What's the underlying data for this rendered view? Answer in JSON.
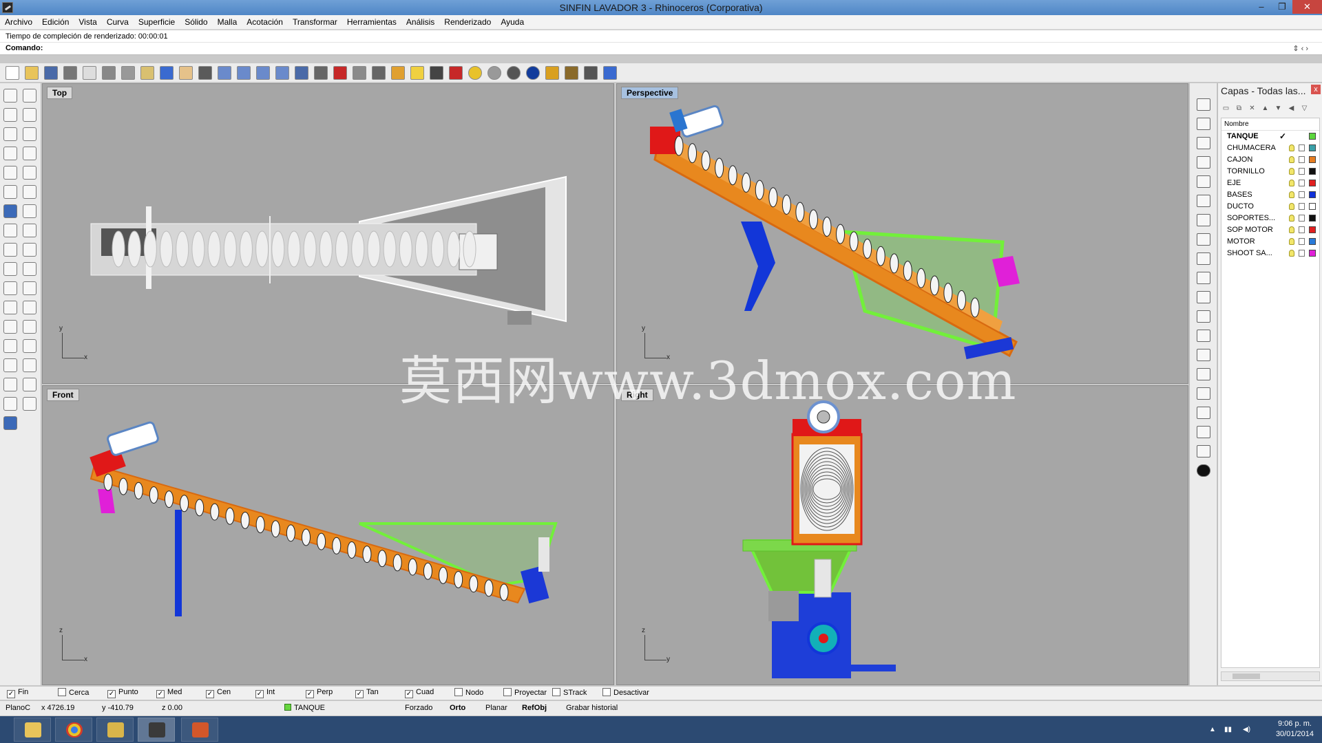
{
  "window": {
    "title": "SINFIN LAVADOR 3 - Rhinoceros (Corporativa)",
    "minimize": "–",
    "maximize": "❐",
    "close": "✕"
  },
  "menu": [
    "Archivo",
    "Edición",
    "Vista",
    "Curva",
    "Superficie",
    "Sólido",
    "Malla",
    "Acotación",
    "Transformar",
    "Herramientas",
    "Análisis",
    "Renderizado",
    "Ayuda"
  ],
  "command": {
    "history": "Tiempo de compleción de renderizado: 00:00:01",
    "prompt": "Comando:",
    "arrows": "⇕   ‹   ›"
  },
  "viewports": {
    "top": {
      "label": "Top",
      "axis_x": "x",
      "axis_y": "y"
    },
    "perspective": {
      "label": "Perspective",
      "axis_x": "x",
      "axis_y": "y"
    },
    "front": {
      "label": "Front",
      "axis_x": "x",
      "axis_y": "z"
    },
    "right": {
      "label": "Right",
      "axis_x": "y",
      "axis_y": "z"
    }
  },
  "layers_panel": {
    "title": "Capas - Todas las...",
    "close": "x",
    "column_header": "Nombre",
    "layers": [
      {
        "name": "TANQUE",
        "current": true,
        "color": "#5bd63c"
      },
      {
        "name": "CHUMACERA",
        "current": false,
        "color": "#3aa0a8"
      },
      {
        "name": "CAJON",
        "current": false,
        "color": "#e67d20"
      },
      {
        "name": "TORNILLO",
        "current": false,
        "color": "#111111"
      },
      {
        "name": "EJE",
        "current": false,
        "color": "#e02020"
      },
      {
        "name": "BASES",
        "current": false,
        "color": "#1030d8"
      },
      {
        "name": "DUCTO",
        "current": false,
        "color": "#ffffff"
      },
      {
        "name": "SOPORTES...",
        "current": false,
        "color": "#111111"
      },
      {
        "name": "SOP MOTOR",
        "current": false,
        "color": "#e02020"
      },
      {
        "name": "MOTOR",
        "current": false,
        "color": "#2a7ad8"
      },
      {
        "name": "SHOOT SA...",
        "current": false,
        "color": "#e020d8"
      }
    ],
    "current_check": "✓"
  },
  "osnaps": [
    {
      "label": "Fin",
      "checked": true
    },
    {
      "label": "Cerca",
      "checked": false
    },
    {
      "label": "Punto",
      "checked": true
    },
    {
      "label": "Med",
      "checked": true
    },
    {
      "label": "Cen",
      "checked": true
    },
    {
      "label": "Int",
      "checked": true
    },
    {
      "label": "Perp",
      "checked": true
    },
    {
      "label": "Tan",
      "checked": true
    },
    {
      "label": "Cuad",
      "checked": true
    },
    {
      "label": "Nodo",
      "checked": false
    },
    {
      "label": "Proyectar",
      "checked": false
    },
    {
      "label": "STrack",
      "checked": false
    },
    {
      "label": "Desactivar",
      "checked": false
    }
  ],
  "status": {
    "plane": "PlanoC",
    "x": "x 4726.19",
    "y": "y -410.79",
    "z": "z 0.00",
    "layer": "TANQUE",
    "forzado": "Forzado",
    "orto": "Orto",
    "planar": "Planar",
    "refobj": "RefObj",
    "historial": "Grabar historial"
  },
  "taskbar": {
    "time": "9:06 p. m.",
    "date": "30/01/2014"
  },
  "watermark": "莫西网www.3dmox.com",
  "icons": {
    "toolbar": [
      "new-file-icon",
      "open-folder-icon",
      "save-icon",
      "print-icon",
      "import-icon",
      "cut-icon",
      "copy-icon",
      "paste-icon",
      "undo-icon",
      "pan-hand-icon",
      "move-icon",
      "zoom-in-icon",
      "zoom-window-icon",
      "zoom-extents-icon",
      "zoom-selected-icon",
      "rotate-view-icon",
      "grid-icon",
      "car-icon",
      "render-preview-icon",
      "camera-icon",
      "snap-icon",
      "light-icon",
      "lock-icon",
      "layer-shield-icon",
      "color-wheel-icon",
      "sphere-wire-icon",
      "sphere-render-icon",
      "blue-sphere-icon",
      "flag-icon",
      "gear-icon",
      "options-icon",
      "help-icon"
    ]
  }
}
